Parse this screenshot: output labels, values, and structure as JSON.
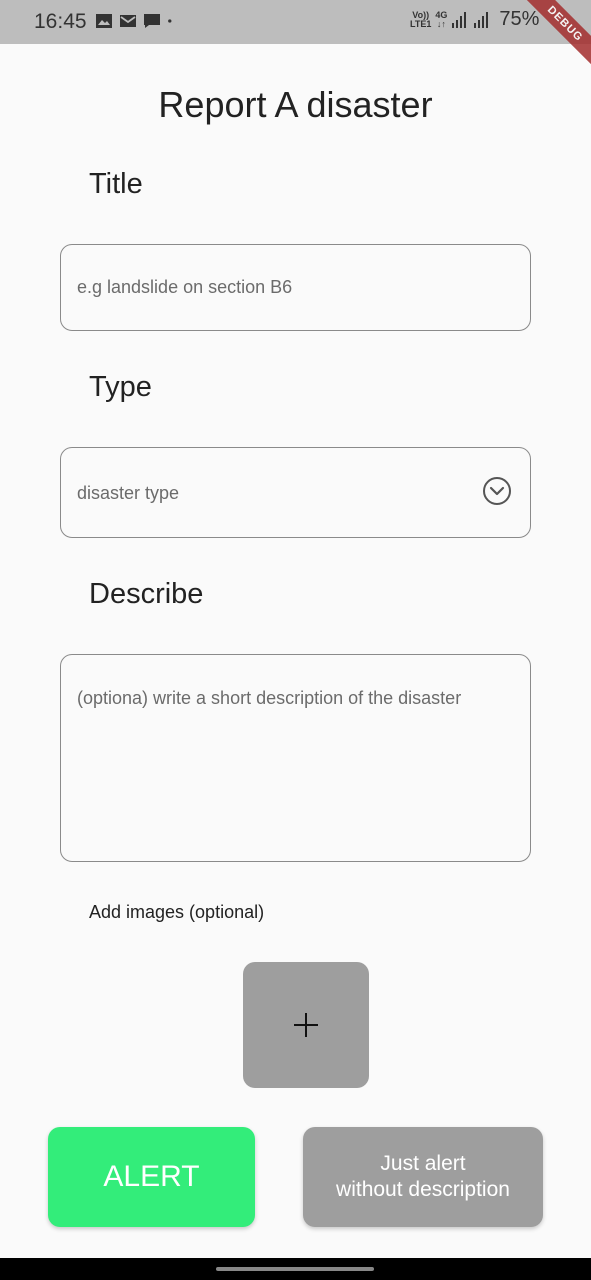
{
  "status_bar": {
    "time": "16:45",
    "network_top": "Vo))",
    "network_bottom": "LTE1",
    "network_type": "4G",
    "battery": "75%"
  },
  "debug_banner": "DEBUG",
  "page": {
    "title": "Report A disaster"
  },
  "form": {
    "title_label": "Title",
    "title_placeholder": "e.g landslide on section B6",
    "type_label": "Type",
    "type_placeholder": "disaster type",
    "describe_label": "Describe",
    "describe_placeholder": "(optiona) write a short description of the disaster",
    "images_label": "Add images (optional)"
  },
  "actions": {
    "alert_label": "ALERT",
    "just_alert_line1": "Just alert",
    "just_alert_line2": "without description"
  },
  "colors": {
    "alert_button": "#33ed7a",
    "secondary_button": "#9e9e9e",
    "status_bar": "#bdbdbd"
  },
  "icons": {
    "dropdown": "chevron-down-circle-icon",
    "add_image": "plus-icon"
  }
}
